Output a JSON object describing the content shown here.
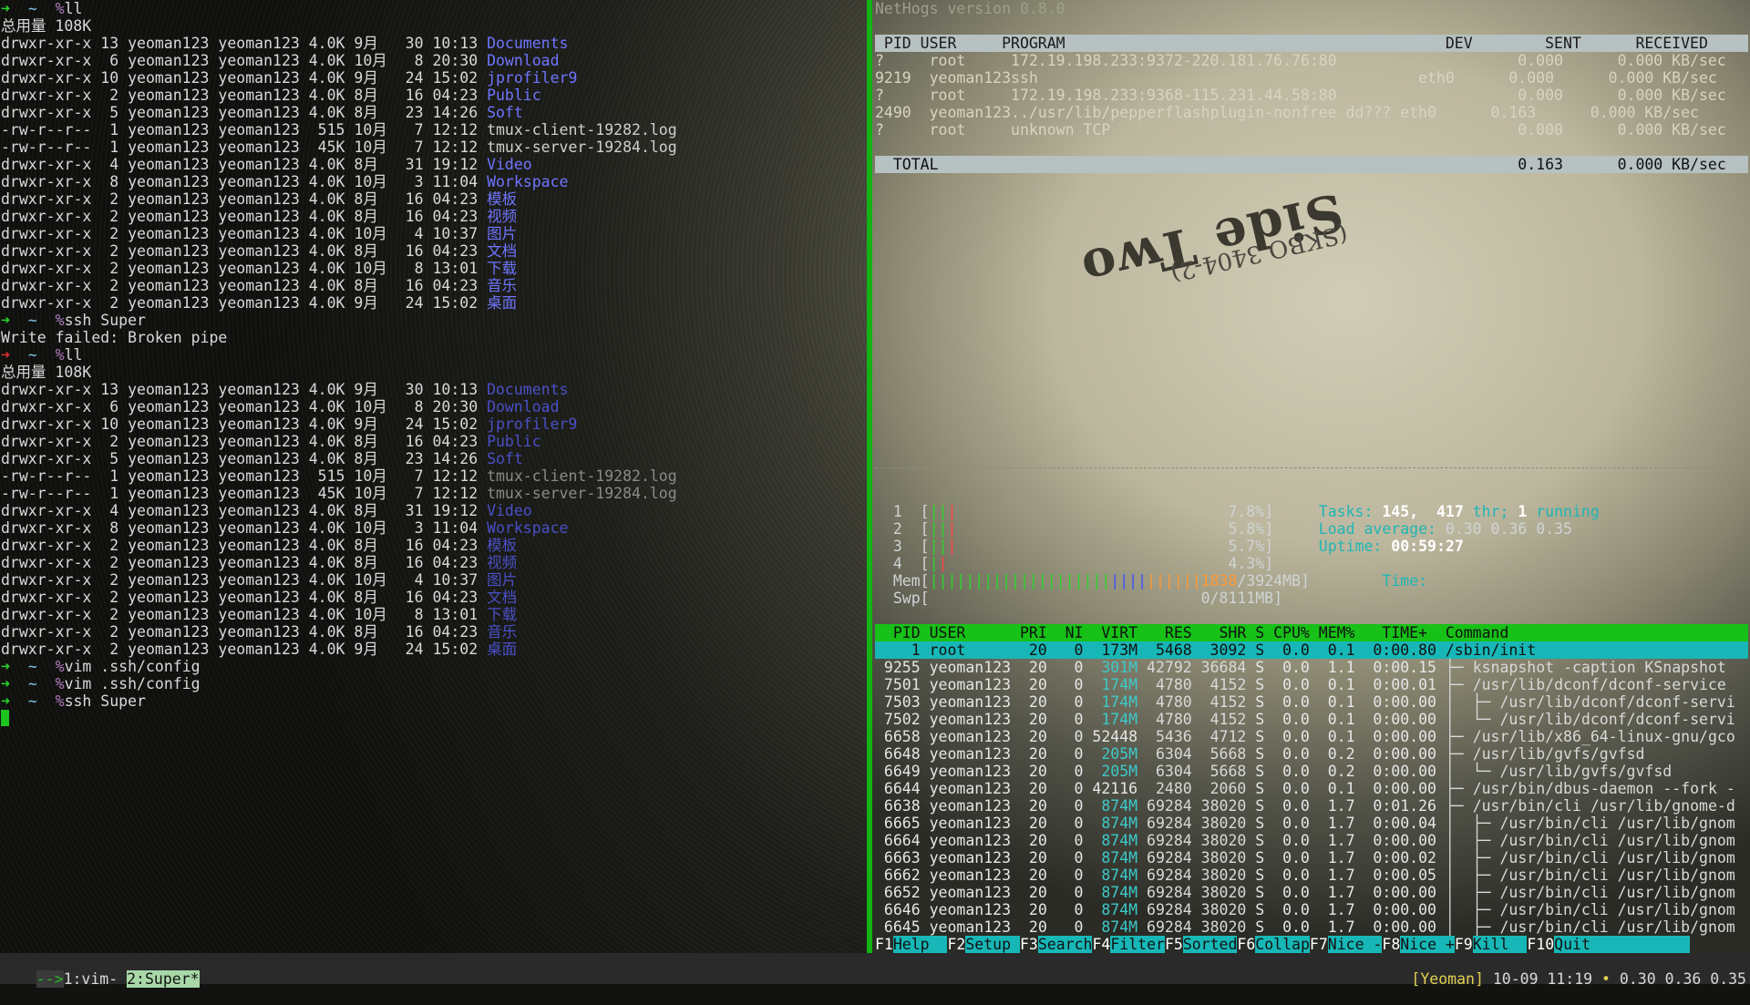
{
  "shell": {
    "prompt_arrow": "➜",
    "prompt_dir": "~",
    "prompt_sym": "%",
    "cmd_ll": "ll",
    "cmd_ssh": "ssh Super",
    "cmd_vim": "vim .ssh/config",
    "total": "总用量 108K",
    "write_failed": "Write failed: Broken pipe"
  },
  "listing": [
    {
      "meta": "drwxr-xr-x 13 yeoman123 yeoman123 4.0K 9月   30 10:13 ",
      "name": "Documents",
      "kind": "dir"
    },
    {
      "meta": "drwxr-xr-x  6 yeoman123 yeoman123 4.0K 10月   8 20:30 ",
      "name": "Download",
      "kind": "dir"
    },
    {
      "meta": "drwxr-xr-x 10 yeoman123 yeoman123 4.0K 9月   24 15:02 ",
      "name": "jprofiler9",
      "kind": "dir"
    },
    {
      "meta": "drwxr-xr-x  2 yeoman123 yeoman123 4.0K 8月   16 04:23 ",
      "name": "Public",
      "kind": "dir"
    },
    {
      "meta": "drwxr-xr-x  5 yeoman123 yeoman123 4.0K 8月   23 14:26 ",
      "name": "Soft",
      "kind": "dir"
    },
    {
      "meta": "-rw-r--r--  1 yeoman123 yeoman123  515 10月   7 12:12 ",
      "name": "tmux-client-19282.log",
      "kind": "file"
    },
    {
      "meta": "-rw-r--r--  1 yeoman123 yeoman123  45K 10月   7 12:12 ",
      "name": "tmux-server-19284.log",
      "kind": "file"
    },
    {
      "meta": "drwxr-xr-x  4 yeoman123 yeoman123 4.0K 8月   31 19:12 ",
      "name": "Video",
      "kind": "dir"
    },
    {
      "meta": "drwxr-xr-x  8 yeoman123 yeoman123 4.0K 10月   3 11:04 ",
      "name": "Workspace",
      "kind": "dir"
    },
    {
      "meta": "drwxr-xr-x  2 yeoman123 yeoman123 4.0K 8月   16 04:23 ",
      "name": "模板",
      "kind": "dir"
    },
    {
      "meta": "drwxr-xr-x  2 yeoman123 yeoman123 4.0K 8月   16 04:23 ",
      "name": "视频",
      "kind": "dir"
    },
    {
      "meta": "drwxr-xr-x  2 yeoman123 yeoman123 4.0K 10月   4 10:37 ",
      "name": "图片",
      "kind": "dir"
    },
    {
      "meta": "drwxr-xr-x  2 yeoman123 yeoman123 4.0K 8月   16 04:23 ",
      "name": "文档",
      "kind": "dir"
    },
    {
      "meta": "drwxr-xr-x  2 yeoman123 yeoman123 4.0K 10月   8 13:01 ",
      "name": "下载",
      "kind": "dir"
    },
    {
      "meta": "drwxr-xr-x  2 yeoman123 yeoman123 4.0K 8月   16 04:23 ",
      "name": "音乐",
      "kind": "dir"
    },
    {
      "meta": "drwxr-xr-x  2 yeoman123 yeoman123 4.0K 9月   24 15:02 ",
      "name": "桌面",
      "kind": "dir"
    }
  ],
  "nethogs": {
    "title": "NetHogs version 0.8.0",
    "header": " PID USER     PROGRAM                                          DEV        SENT      RECEIVED",
    "rows": [
      "?     root     172.19.198.233:9372-220.181.76.76:80                    0.000      0.000 KB/sec",
      "9219  yeoman123ssh                                          eth0      0.000      0.000 KB/sec",
      "?     root     172.19.198.233:9368-115.231.44.58:80                    0.000      0.000 KB/sec",
      "2490  yeoman123../usr/lib/pepperflashplugin-nonfree dd??? eth0      0.163      0.000 KB/sec",
      "?     root     unknown TCP                                             0.000      0.000 KB/sec"
    ],
    "total": "  TOTAL                                                                0.163      0.000 KB/sec"
  },
  "htop": {
    "cpus": [
      {
        "id": "1",
        "bars": "|||",
        "pct": "7.8%"
      },
      {
        "id": "2",
        "bars": "|||",
        "pct": "5.8%"
      },
      {
        "id": "3",
        "bars": "|||",
        "pct": "5.7%"
      },
      {
        "id": "4",
        "bars": "||",
        "pct": "4.3%"
      }
    ],
    "mem_label": "Mem",
    "mem_bars_green": "||||||||||||||||||||",
    "mem_bars_blue": "||||",
    "mem_bars_orange": "||||||",
    "mem_value": "1838",
    "mem_total": "/3924MB",
    "swp_label": "Swp",
    "swp_value": "0/8111MB",
    "tasks_label": "Tasks:",
    "tasks": "145",
    "thr": "417",
    "thr_label": "thr;",
    "running": "1",
    "running_label": "running",
    "load_label": "Load average:",
    "load1": "0.30",
    "load5": "0.36",
    "load15": "0.35",
    "uptime_label": "Uptime:",
    "uptime": "00:59:27",
    "time_label": "Time:",
    "header": "  PID USER      PRI  NI  VIRT   RES   SHR S CPU% MEM%   TIME+  Command",
    "selected": "    1 root       20   0  173M  5468  3092 S  0.0  0.1  0:00.80 /sbin/init",
    "rows": [
      {
        "pid": " 9255",
        "user": "yeoman123",
        "pri": "20",
        "ni": "0",
        "virt": "301M",
        "res": "42792",
        "shr": "36684",
        "s": "S",
        "cpu": "0.0",
        "mem": "1.1",
        "time": "0:00.15",
        "tree": "├─ ",
        "cmd": "ksnapshot -caption KSnapshot"
      },
      {
        "pid": " 7501",
        "user": "yeoman123",
        "pri": "20",
        "ni": "0",
        "virt": "174M",
        "res": "4780",
        "shr": "4152",
        "s": "S",
        "cpu": "0.0",
        "mem": "0.1",
        "time": "0:00.01",
        "tree": "├─ ",
        "cmd": "/usr/lib/dconf/dconf-service"
      },
      {
        "pid": " 7503",
        "user": "yeoman123",
        "pri": "20",
        "ni": "0",
        "virt": "174M",
        "res": "4780",
        "shr": "4152",
        "s": "S",
        "cpu": "0.0",
        "mem": "0.1",
        "time": "0:00.00",
        "tree": "│  ├─ ",
        "cmd": "/usr/lib/dconf/dconf-servi"
      },
      {
        "pid": " 7502",
        "user": "yeoman123",
        "pri": "20",
        "ni": "0",
        "virt": "174M",
        "res": "4780",
        "shr": "4152",
        "s": "S",
        "cpu": "0.0",
        "mem": "0.1",
        "time": "0:00.00",
        "tree": "│  └─ ",
        "cmd": "/usr/lib/dconf/dconf-servi"
      },
      {
        "pid": " 6658",
        "user": "yeoman123",
        "pri": "20",
        "ni": "0",
        "virt": "52448",
        "res": "5436",
        "shr": "4712",
        "s": "S",
        "cpu": "0.0",
        "mem": "0.1",
        "time": "0:00.00",
        "tree": "├─ ",
        "cmd": "/usr/lib/x86_64-linux-gnu/gco"
      },
      {
        "pid": " 6648",
        "user": "yeoman123",
        "pri": "20",
        "ni": "0",
        "virt": "205M",
        "res": "6304",
        "shr": "5668",
        "s": "S",
        "cpu": "0.0",
        "mem": "0.2",
        "time": "0:00.00",
        "tree": "├─ ",
        "cmd": "/usr/lib/gvfs/gvfsd"
      },
      {
        "pid": " 6649",
        "user": "yeoman123",
        "pri": "20",
        "ni": "0",
        "virt": "205M",
        "res": "6304",
        "shr": "5668",
        "s": "S",
        "cpu": "0.0",
        "mem": "0.2",
        "time": "0:00.00",
        "tree": "│  └─ ",
        "cmd": "/usr/lib/gvfs/gvfsd"
      },
      {
        "pid": " 6644",
        "user": "yeoman123",
        "pri": "20",
        "ni": "0",
        "virt": "42116",
        "res": "2480",
        "shr": "2060",
        "s": "S",
        "cpu": "0.0",
        "mem": "0.1",
        "time": "0:00.00",
        "tree": "├─ ",
        "cmd": "/usr/bin/dbus-daemon --fork -"
      },
      {
        "pid": " 6638",
        "user": "yeoman123",
        "pri": "20",
        "ni": "0",
        "virt": "874M",
        "res": "69284",
        "shr": "38020",
        "s": "S",
        "cpu": "0.0",
        "mem": "1.7",
        "time": "0:01.26",
        "tree": "├─ ",
        "cmd": "/usr/bin/cli /usr/lib/gnome-d"
      },
      {
        "pid": " 6665",
        "user": "yeoman123",
        "pri": "20",
        "ni": "0",
        "virt": "874M",
        "res": "69284",
        "shr": "38020",
        "s": "S",
        "cpu": "0.0",
        "mem": "1.7",
        "time": "0:00.04",
        "tree": "│  ├─ ",
        "cmd": "/usr/bin/cli /usr/lib/gnom"
      },
      {
        "pid": " 6664",
        "user": "yeoman123",
        "pri": "20",
        "ni": "0",
        "virt": "874M",
        "res": "69284",
        "shr": "38020",
        "s": "S",
        "cpu": "0.0",
        "mem": "1.7",
        "time": "0:00.00",
        "tree": "│  ├─ ",
        "cmd": "/usr/bin/cli /usr/lib/gnom"
      },
      {
        "pid": " 6663",
        "user": "yeoman123",
        "pri": "20",
        "ni": "0",
        "virt": "874M",
        "res": "69284",
        "shr": "38020",
        "s": "S",
        "cpu": "0.0",
        "mem": "1.7",
        "time": "0:00.02",
        "tree": "│  ├─ ",
        "cmd": "/usr/bin/cli /usr/lib/gnom"
      },
      {
        "pid": " 6662",
        "user": "yeoman123",
        "pri": "20",
        "ni": "0",
        "virt": "874M",
        "res": "69284",
        "shr": "38020",
        "s": "S",
        "cpu": "0.0",
        "mem": "1.7",
        "time": "0:00.05",
        "tree": "│  ├─ ",
        "cmd": "/usr/bin/cli /usr/lib/gnom"
      },
      {
        "pid": " 6652",
        "user": "yeoman123",
        "pri": "20",
        "ni": "0",
        "virt": "874M",
        "res": "69284",
        "shr": "38020",
        "s": "S",
        "cpu": "0.0",
        "mem": "1.7",
        "time": "0:00.00",
        "tree": "│  ├─ ",
        "cmd": "/usr/bin/cli /usr/lib/gnom"
      },
      {
        "pid": " 6646",
        "user": "yeoman123",
        "pri": "20",
        "ni": "0",
        "virt": "874M",
        "res": "69284",
        "shr": "38020",
        "s": "S",
        "cpu": "0.0",
        "mem": "1.7",
        "time": "0:00.00",
        "tree": "│  ├─ ",
        "cmd": "/usr/bin/cli /usr/lib/gnom"
      },
      {
        "pid": " 6645",
        "user": "yeoman123",
        "pri": "20",
        "ni": "0",
        "virt": "874M",
        "res": "69284",
        "shr": "38020",
        "s": "S",
        "cpu": "0.0",
        "mem": "1.7",
        "time": "0:00.00",
        "tree": "│  ├─ ",
        "cmd": "/usr/bin/cli /usr/lib/gnom"
      }
    ],
    "fkeys": [
      {
        "k": "F1",
        "l": "Help  "
      },
      {
        "k": "F2",
        "l": "Setup "
      },
      {
        "k": "F3",
        "l": "Search"
      },
      {
        "k": "F4",
        "l": "Filter"
      },
      {
        "k": "F5",
        "l": "Sorted"
      },
      {
        "k": "F6",
        "l": "Collap"
      },
      {
        "k": "F7",
        "l": "Nice -"
      },
      {
        "k": "F8",
        "l": "Nice +"
      },
      {
        "k": "F9",
        "l": "Kill  "
      },
      {
        "k": "F10",
        "l": "Quit           "
      }
    ]
  },
  "tmux": {
    "arrow": "-->",
    "win1": "1:vim-",
    "win2": "2:Super*",
    "session": "[Yeoman]",
    "datetime": "10-09 11:19",
    "bullet": "•",
    "load": "0.30 0.36 0.35"
  },
  "disc": {
    "label_line1": "Side Two",
    "label_line2": "(SKBO 3404-2)"
  }
}
